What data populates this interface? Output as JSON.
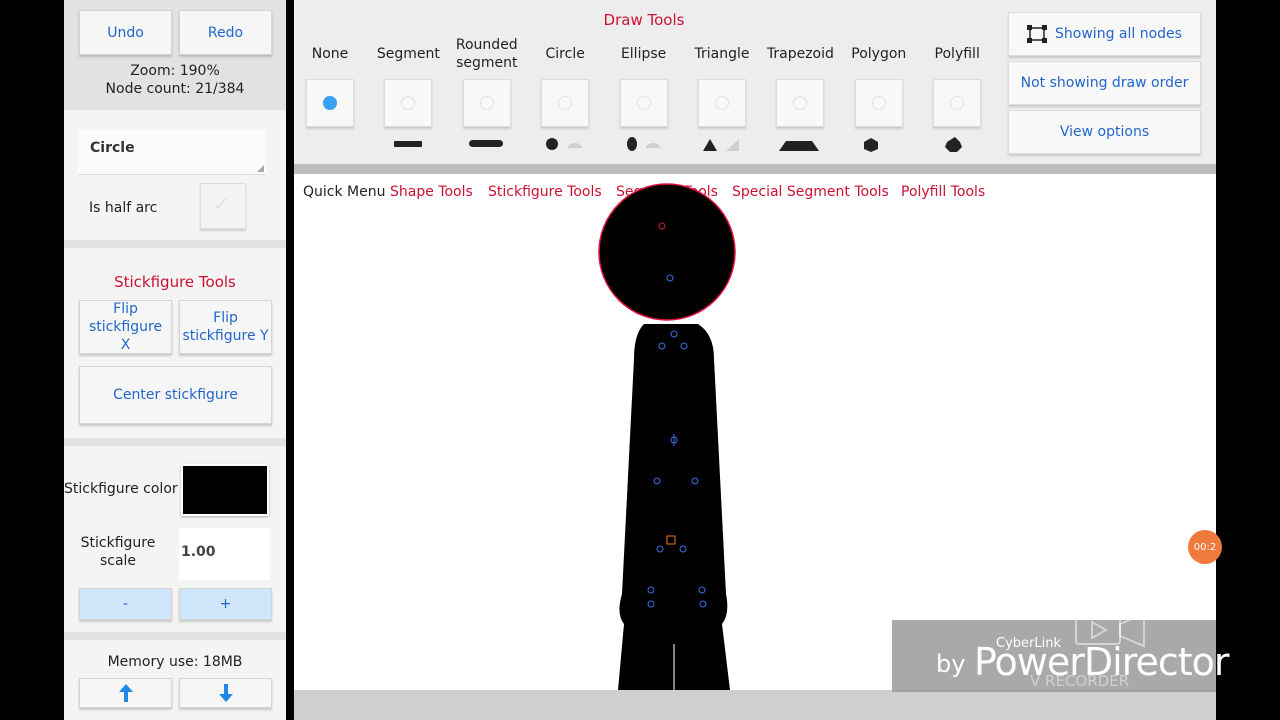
{
  "left": {
    "undo": "Undo",
    "redo": "Redo",
    "zoom": "Zoom: 190%",
    "node_count": "Node count: 21/384",
    "shape_type": "Circle",
    "half_arc_label": "Is half arc",
    "stick_tools_title": "Stickfigure Tools",
    "flip_x": "Flip stickfigure X",
    "flip_y": "Flip stickfigure Y",
    "center": "Center stickfigure",
    "color_label": "Stickfigure color",
    "color_value": "#000000",
    "scale_label": "Stickfigure scale",
    "scale_value": "1.00",
    "minus": "-",
    "plus": "+",
    "memory": "Memory use: 18MB"
  },
  "toolbar": {
    "title": "Draw Tools",
    "tools": [
      {
        "name": "None",
        "selected": true
      },
      {
        "name": "Segment",
        "selected": false
      },
      {
        "name": "Rounded segment",
        "selected": false
      },
      {
        "name": "Circle",
        "selected": false
      },
      {
        "name": "Ellipse",
        "selected": false
      },
      {
        "name": "Triangle",
        "selected": false
      },
      {
        "name": "Trapezoid",
        "selected": false
      },
      {
        "name": "Polygon",
        "selected": false
      },
      {
        "name": "Polyfill",
        "selected": false
      }
    ],
    "showing_nodes": "Showing all nodes",
    "draw_order": "Not showing draw order",
    "view_options": "View options"
  },
  "quick_menu": {
    "label": "Quick Menu",
    "items": [
      "Shape Tools",
      "Stickfigure Tools",
      "Segment Tools",
      "Special Segment Tools",
      "Polyfill Tools"
    ]
  },
  "watermark": {
    "by": "by",
    "cyberlink": "CyberLink",
    "brand": "PowerDirector",
    "recorder": "V RECORDER",
    "badge": "00:2"
  },
  "colors": {
    "accent_blue": "#2266cc",
    "section_red": "#cc1133",
    "selected_radio": "#3aa0f0"
  }
}
